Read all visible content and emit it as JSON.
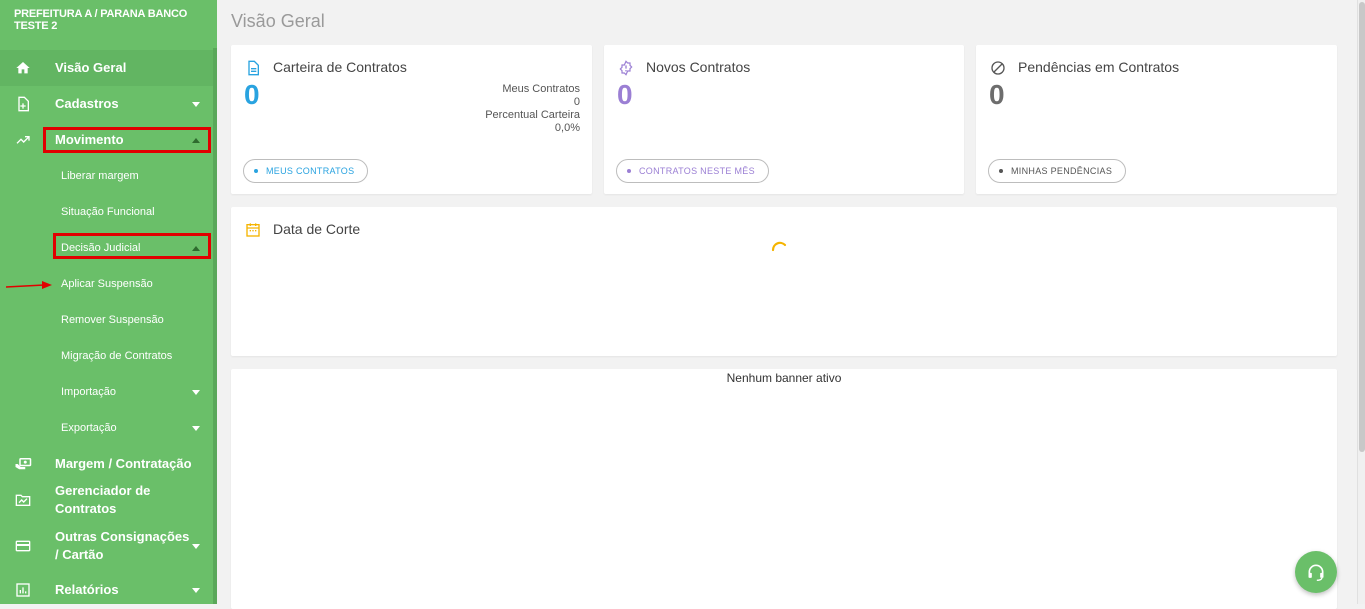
{
  "sidebar": {
    "org_name": "PREFEITURA A / PARANA BANCO TESTE 2",
    "items": [
      {
        "label": "Visão Geral",
        "icon": "home-icon"
      },
      {
        "label": "Cadastros",
        "icon": "file-plus-icon"
      },
      {
        "label": "Movimento",
        "icon": "trending-up-icon"
      },
      {
        "label": "Liberar margem"
      },
      {
        "label": "Situação Funcional"
      },
      {
        "label": "Decisão Judicial"
      },
      {
        "label": "Aplicar Suspensão"
      },
      {
        "label": "Remover Suspensão"
      },
      {
        "label": "Migração de Contratos"
      },
      {
        "label": "Importação"
      },
      {
        "label": "Exportação"
      },
      {
        "label": "Margem / Contratação",
        "icon": "hand-money-icon"
      },
      {
        "label": "Gerenciador de Contratos",
        "icon": "folder-chart-icon"
      },
      {
        "label": "Outras Consignações / Cartão",
        "icon": "credit-card-icon"
      },
      {
        "label": "Relatórios",
        "icon": "bar-chart-icon"
      }
    ]
  },
  "main": {
    "page_title": "Visão Geral",
    "cards": [
      {
        "title": "Carteira de Contratos",
        "value": "0",
        "color": "#29a3e0",
        "stat1_label": "Meus Contratos",
        "stat1_value": "0",
        "stat2_label": "Percentual Carteira",
        "stat2_value": "0,0%",
        "chip": "MEUS CONTRATOS"
      },
      {
        "title": "Novos Contratos",
        "value": "0",
        "color": "#9b7fd4",
        "chip": "CONTRATOS NESTE MÊS"
      },
      {
        "title": "Pendências em Contratos",
        "value": "0",
        "color": "#6d6d6d",
        "chip": "MINHAS PENDÊNCIAS"
      }
    ],
    "cutoff": {
      "title": "Data de Corte",
      "color": "#f5b400"
    },
    "banner": {
      "text": "Nenhum banner ativo"
    }
  },
  "colors": {
    "sidebar": "#6abf69",
    "highlight": "#e10000"
  }
}
